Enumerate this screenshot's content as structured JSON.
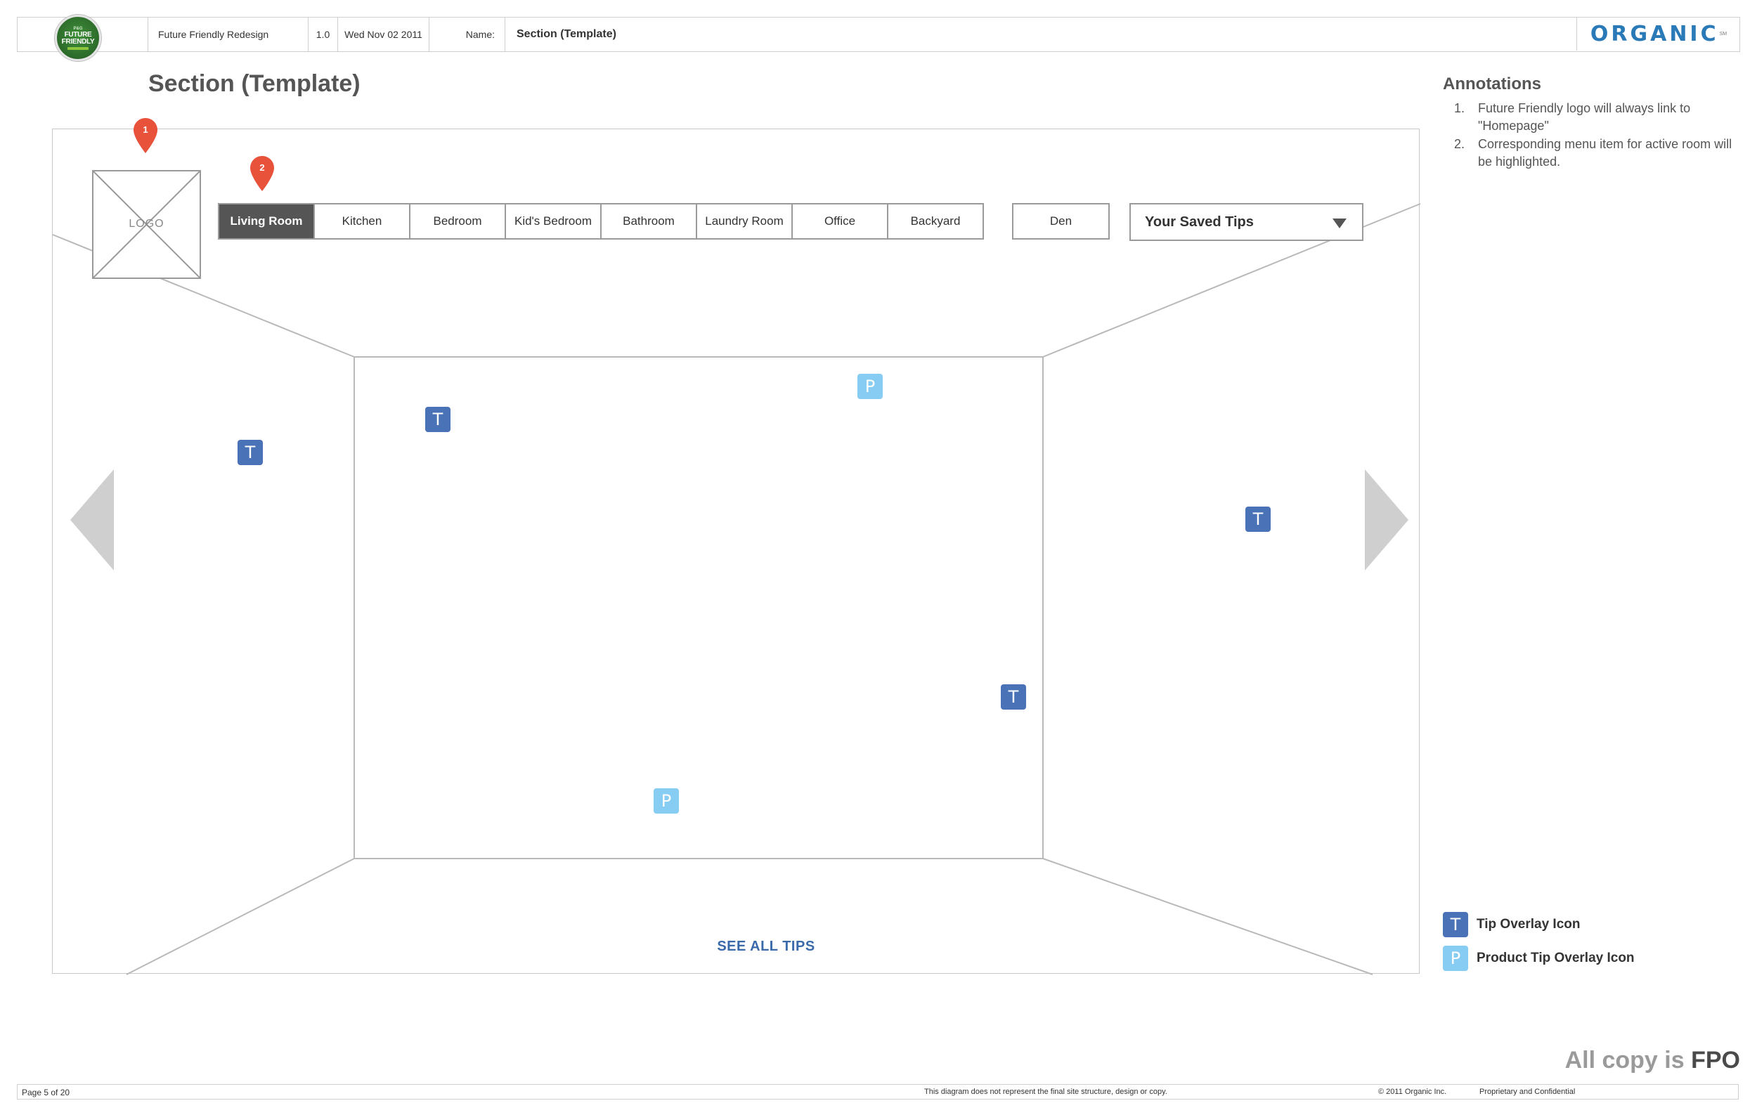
{
  "header": {
    "project": "Future Friendly Redesign",
    "version": "1.0",
    "date": "Wed Nov 02 2011",
    "name_label": "Name:",
    "name_value": "Section (Template)",
    "ff_logo": {
      "line1": "P&G",
      "line2": "FUTURE",
      "line3": "FRIENDLY"
    },
    "organic_logo": {
      "text": "ORGANIC",
      "mark": "SM"
    }
  },
  "page_title": "Section (Template)",
  "annotations": {
    "title": "Annotations",
    "items": [
      {
        "num": "1.",
        "text": "Future Friendly logo will always link to \"Homepage\""
      },
      {
        "num": "2.",
        "text": "Corresponding menu item for active room will be highlighted."
      }
    ]
  },
  "wireframe": {
    "logo_placeholder": "LOGO",
    "markers": [
      "1",
      "2"
    ],
    "rooms": [
      {
        "label": "Living Room",
        "active": true
      },
      {
        "label": "Kitchen",
        "active": false
      },
      {
        "label": "Bedroom",
        "active": false
      },
      {
        "label": "Kid's Bedroom",
        "active": false
      },
      {
        "label": "Bathroom",
        "active": false
      },
      {
        "label": "Laundry Room",
        "active": false
      },
      {
        "label": "Office",
        "active": false
      },
      {
        "label": "Backyard",
        "active": false
      }
    ],
    "den": "Den",
    "saved_tips": "Your Saved Tips",
    "tip_letter": "T",
    "product_letter": "P",
    "see_all_tips": "SEE ALL TIPS"
  },
  "legend": {
    "tip": {
      "icon": "T",
      "label": "Tip Overlay Icon",
      "color": "#4a72b6"
    },
    "product": {
      "icon": "P",
      "label": "Product Tip Overlay Icon",
      "color": "#87cdf3"
    }
  },
  "fpo": {
    "prefix": "All copy is ",
    "bold": "FPO"
  },
  "footer": {
    "page": "Page 5 of 20",
    "disclaimer": "This diagram does not represent the final site structure, design or copy.",
    "copyright": "© 2011 Organic Inc.",
    "confidential": "Proprietary and Confidential"
  },
  "colors": {
    "accent_blue": "#2a7ab8",
    "marker_red": "#e8513a",
    "active_tab": "#555555"
  }
}
